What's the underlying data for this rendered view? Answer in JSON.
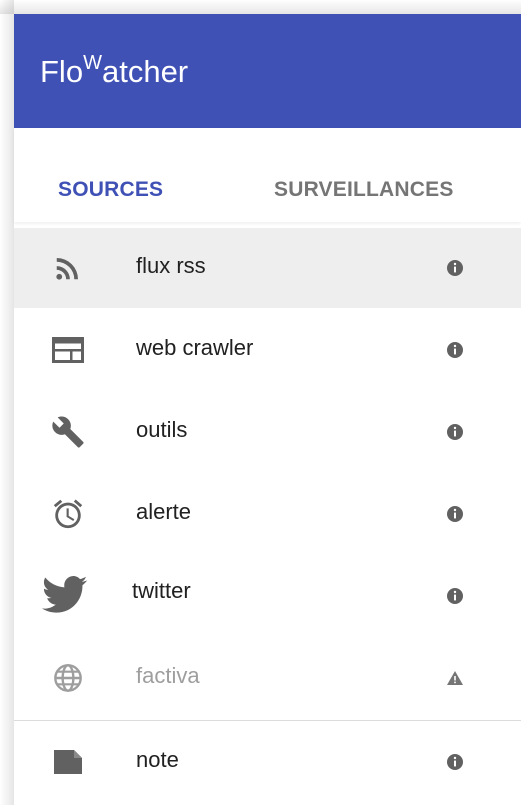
{
  "app": {
    "title_prefix": "Flo",
    "title_sup": "W",
    "title_suffix": "atcher"
  },
  "colors": {
    "primary": "#3f51b5",
    "selected_row": "#eeeeee",
    "icon": "#616161",
    "disabled": "#9e9e9e"
  },
  "tabs": [
    {
      "label": "SOURCES",
      "active": true
    },
    {
      "label": "SURVEILLANCES",
      "active": false
    }
  ],
  "sources": [
    {
      "label": "flux rss",
      "icon": "rss-icon",
      "status_icon": "info-icon",
      "selected": true
    },
    {
      "label": "web crawler",
      "icon": "web-crawler-icon",
      "status_icon": "info-icon"
    },
    {
      "label": "outils",
      "icon": "wrench-icon",
      "status_icon": "info-icon"
    },
    {
      "label": "alerte",
      "icon": "alarm-icon",
      "status_icon": "info-icon"
    },
    {
      "label": "twitter",
      "icon": "twitter-icon",
      "status_icon": "info-icon"
    },
    {
      "label": "factiva",
      "icon": "globe-icon",
      "status_icon": "warning-icon",
      "disabled": true
    },
    {
      "label": "note",
      "icon": "note-icon",
      "status_icon": "info-icon"
    }
  ]
}
